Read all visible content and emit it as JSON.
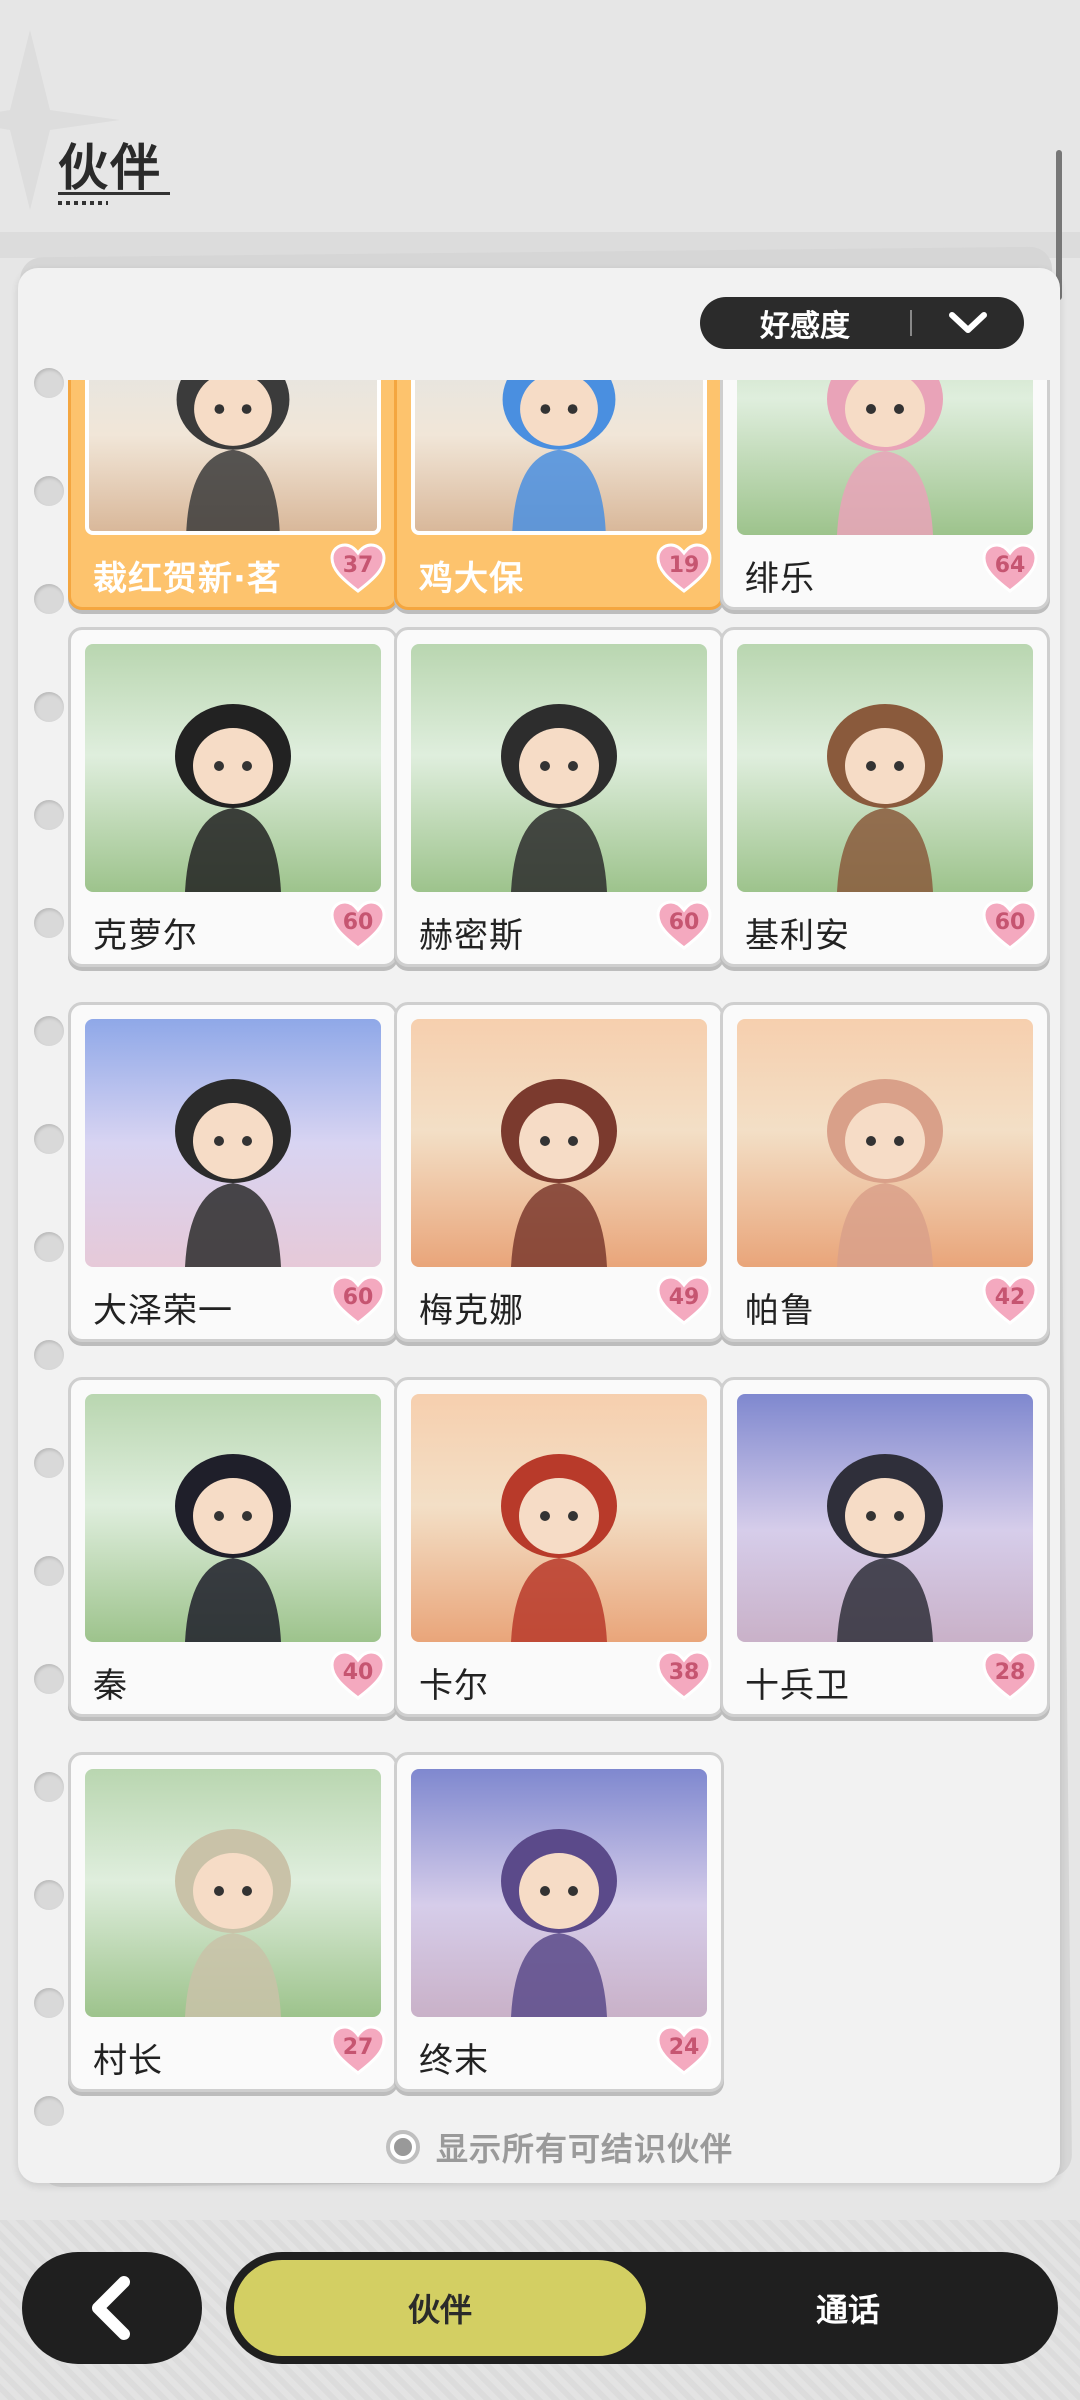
{
  "header": {
    "title": "伙伴"
  },
  "sort": {
    "label": "好感度",
    "icon": "chevron-down-icon"
  },
  "partners": [
    {
      "name": "裁红贺新·茗",
      "affection": "37",
      "highlight": true,
      "bg": "town"
    },
    {
      "name": "鸡大保",
      "affection": "19",
      "highlight": true,
      "bg": "town"
    },
    {
      "name": "绯乐",
      "affection": "64",
      "highlight": false,
      "bg": "forest"
    },
    {
      "name": "克萝尔",
      "affection": "60",
      "highlight": false,
      "bg": "forest"
    },
    {
      "name": "赫密斯",
      "affection": "60",
      "highlight": false,
      "bg": "forest"
    },
    {
      "name": "基利安",
      "affection": "60",
      "highlight": false,
      "bg": "forest"
    },
    {
      "name": "大泽荣一",
      "affection": "60",
      "highlight": false,
      "bg": "sky"
    },
    {
      "name": "梅克娜",
      "affection": "49",
      "highlight": false,
      "bg": "desert"
    },
    {
      "name": "帕鲁",
      "affection": "42",
      "highlight": false,
      "bg": "desert"
    },
    {
      "name": "秦",
      "affection": "40",
      "highlight": false,
      "bg": "forest"
    },
    {
      "name": "卡尔",
      "affection": "38",
      "highlight": false,
      "bg": "desert"
    },
    {
      "name": "十兵卫",
      "affection": "28",
      "highlight": false,
      "bg": "dusk"
    },
    {
      "name": "村长",
      "affection": "27",
      "highlight": false,
      "bg": "forest"
    },
    {
      "name": "终末",
      "affection": "24",
      "highlight": false,
      "bg": "dusk"
    }
  ],
  "show_all": {
    "label": "显示所有可结识伙伴"
  },
  "nav": {
    "back_icon": "back-arrow-icon",
    "tab_partner": "伙伴",
    "tab_call": "通话"
  },
  "colors": {
    "highlight": "#fdc36d",
    "active_tab": "#d3cf63",
    "heart": "#f4a9bf",
    "dark": "#1f1f1f"
  }
}
